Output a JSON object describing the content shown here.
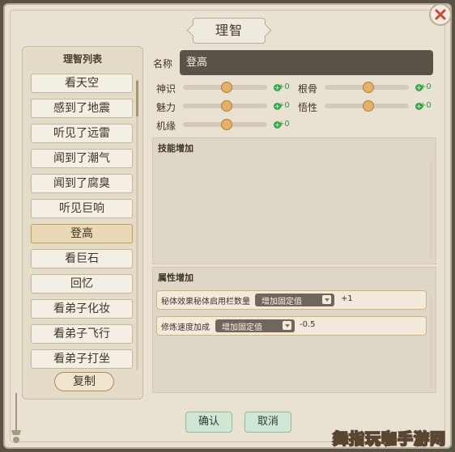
{
  "title": "理智",
  "list": {
    "header": "理智列表",
    "items": [
      "看天空",
      "感到了地震",
      "听见了远雷",
      "闻到了潮气",
      "闻到了腐臭",
      "听见巨响",
      "登高",
      "看巨石",
      "回忆",
      "看弟子化妆",
      "看弟子飞行",
      "看弟子打坐"
    ],
    "selected_index": 6,
    "copy_label": "复制"
  },
  "form": {
    "name_label": "名称",
    "name_value": "登高",
    "stats": [
      {
        "label": "神识",
        "value": "+0"
      },
      {
        "label": "根骨",
        "value": "+0"
      },
      {
        "label": "魅力",
        "value": "+0"
      },
      {
        "label": "悟性",
        "value": "+0"
      },
      {
        "label": "机缘",
        "value": "+0"
      }
    ]
  },
  "skill_section": {
    "title": "技能增加"
  },
  "attribute_section": {
    "title": "属性增加",
    "rows": [
      {
        "label": "秘体效果秘体启用栏数量",
        "mode": "增加固定值",
        "value": "+1"
      },
      {
        "label": "修炼速度加成",
        "mode": "增加固定值",
        "value": "-0.5"
      }
    ]
  },
  "buttons": {
    "confirm": "确认",
    "cancel": "取消"
  },
  "watermark": "舞指玩咖手游网",
  "colors": {
    "accent_green": "#2c9a3b",
    "slider_thumb": "#e5b06b",
    "selected_item": "#ead9b5"
  }
}
